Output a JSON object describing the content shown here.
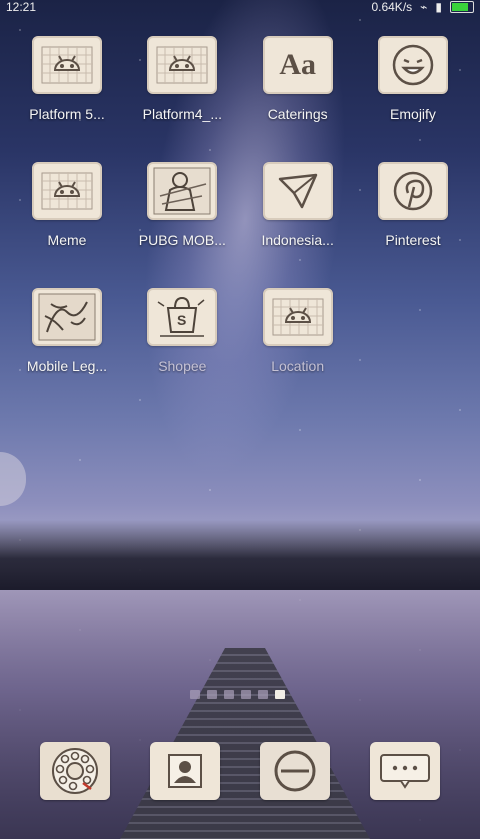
{
  "status_bar": {
    "time": "12:21",
    "speed": "0.64K/s",
    "battery_color": "#39d23b"
  },
  "apps": [
    {
      "label": "Platform 5...",
      "icon": "android-grid-icon"
    },
    {
      "label": "Platform4_...",
      "icon": "android-grid-icon"
    },
    {
      "label": "Caterings",
      "icon": "font-aa-icon"
    },
    {
      "label": "Emojify",
      "icon": "smiley-icon"
    },
    {
      "label": "Meme",
      "icon": "android-grid-icon"
    },
    {
      "label": "PUBG MOB...",
      "icon": "pubg-sketch-icon"
    },
    {
      "label": "Indonesia...",
      "icon": "paper-plane-icon"
    },
    {
      "label": "Pinterest",
      "icon": "pinterest-icon"
    },
    {
      "label": "Mobile Leg...",
      "icon": "mobile-legends-icon"
    },
    {
      "label": "Shopee",
      "icon": "shopee-bag-icon"
    },
    {
      "label": "Location",
      "icon": "android-grid-icon"
    }
  ],
  "pager": {
    "count": 6,
    "active": 5
  },
  "dock": [
    {
      "name": "phone",
      "icon": "rotary-phone-icon"
    },
    {
      "name": "contacts",
      "icon": "contact-card-icon"
    },
    {
      "name": "browser",
      "icon": "browser-e-icon"
    },
    {
      "name": "messages",
      "icon": "speech-bubble-icon"
    }
  ]
}
